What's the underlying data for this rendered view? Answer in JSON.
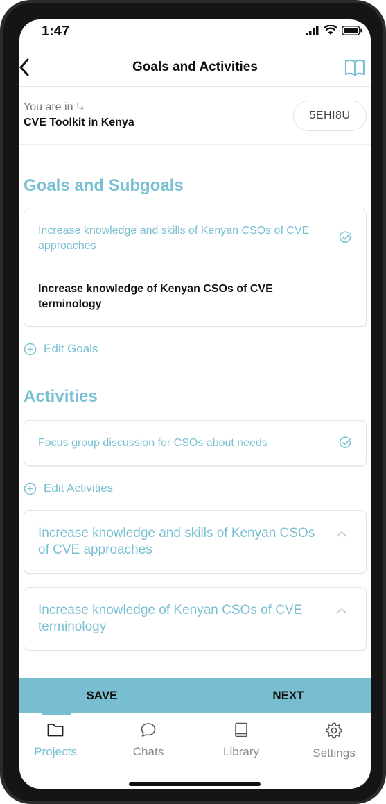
{
  "status": {
    "time": "1:47"
  },
  "nav": {
    "title": "Goals and Activities",
    "back_icon": "back-chevron-icon",
    "book_icon": "book-icon"
  },
  "location": {
    "label": "You are in",
    "label_icon": "arrow-down-right-icon",
    "project": "CVE Toolkit in Kenya",
    "code": "5EHI8U"
  },
  "goals": {
    "heading": "Goals and Subgoals",
    "items": [
      {
        "text": "Increase knowledge and skills of Kenyan CSOs of CVE approaches",
        "selected": true
      },
      {
        "text": "Increase knowledge of Kenyan CSOs of CVE terminology",
        "selected": false
      }
    ],
    "edit_label": "Edit Goals"
  },
  "activities": {
    "heading": "Activities",
    "items": [
      {
        "text": "Focus group discussion for CSOs about needs",
        "selected": true
      }
    ],
    "edit_label": "Edit Activities"
  },
  "accordions": [
    {
      "title": "Increase knowledge and skills of Kenyan CSOs of CVE approaches",
      "expanded": true
    },
    {
      "title": "Increase knowledge of Kenyan CSOs of CVE terminology",
      "expanded": true
    }
  ],
  "actions": {
    "save": "SAVE",
    "next": "NEXT"
  },
  "tabs": [
    {
      "label": "Projects",
      "icon": "folder-icon",
      "active": true
    },
    {
      "label": "Chats",
      "icon": "chat-bubble-icon",
      "active": false
    },
    {
      "label": "Library",
      "icon": "book-icon",
      "active": false
    },
    {
      "label": "Settings",
      "icon": "gear-icon",
      "active": false
    }
  ],
  "colors": {
    "accent": "#79c0d2",
    "action_bar": "#79bed0",
    "text": "#111111",
    "muted": "#8a8a8a"
  }
}
